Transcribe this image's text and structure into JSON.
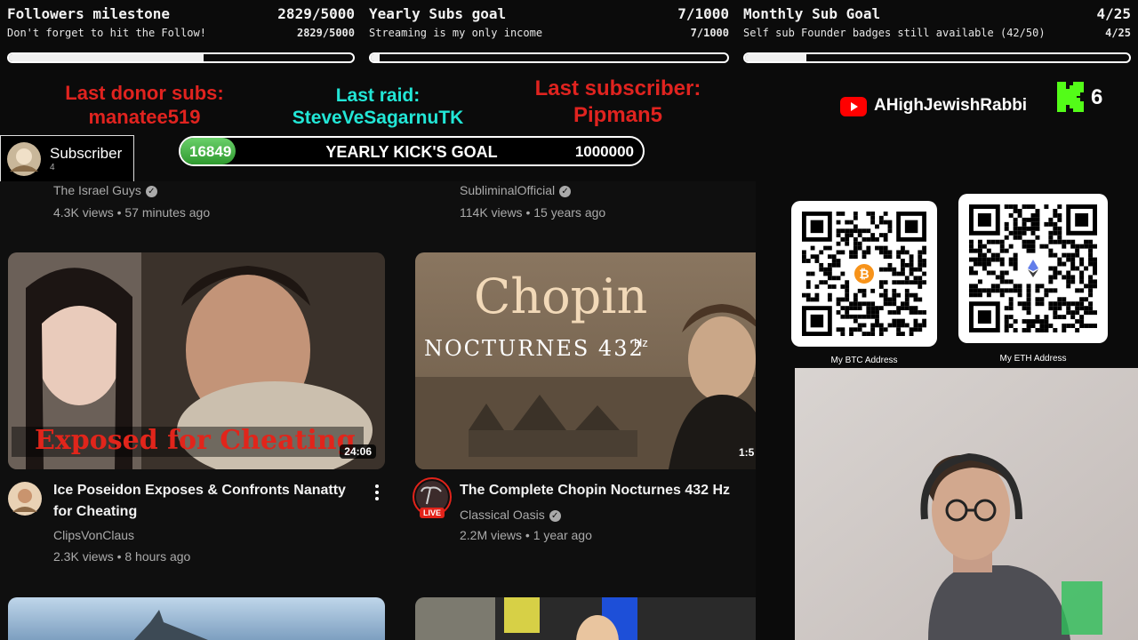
{
  "goals": [
    {
      "title": "Followers milestone",
      "value": "2829/5000",
      "subtitle": "Don't forget to hit the Follow!",
      "sub_value": "2829/5000",
      "progress": 0.566
    },
    {
      "title": "Yearly Subs goal",
      "value": "7/1000",
      "subtitle": "Streaming is my only income",
      "sub_value": "7/1000",
      "progress": 0.007
    },
    {
      "title": "Monthly Sub Goal",
      "value": "4/25",
      "subtitle": "Self sub Founder badges still available (42/50)",
      "sub_value": "4/25",
      "progress": 0.16
    }
  ],
  "alerts": {
    "donor_label": "Last donor subs:",
    "donor_name": "manatee519",
    "raid_label": "Last raid:",
    "raid_name": "SteveVeSagarnuTK",
    "sub_label": "Last subscriber:",
    "sub_name": "Pipman5"
  },
  "kick_goal": {
    "current": "16849",
    "title": "YEARLY KICK'S GOAL",
    "max": "1000000",
    "progress": 0.016849
  },
  "subscriber_box": {
    "label": "Subscriber",
    "count": "4"
  },
  "youtube": {
    "channel": "AHighJewishRabbi"
  },
  "kick_badge": {
    "count": "6"
  },
  "feed": {
    "top_left": {
      "channel": "The Israel Guys",
      "meta": "4.3K views • 57 minutes ago"
    },
    "top_right": {
      "channel": "SubliminalOfficial",
      "meta": "114K views • 15 years ago"
    },
    "video1": {
      "title_line1": "Ice Poseidon Exposes & Confronts Nanatty",
      "title_line2": "for Cheating",
      "channel": "ClipsVonClaus",
      "meta": "2.3K views • 8 hours ago",
      "duration": "24:06",
      "thumb_text": "Exposed for Cheating"
    },
    "video2": {
      "title": "The Complete Chopin Nocturnes 432 Hz",
      "channel": "Classical Oasis",
      "meta": "2.2M views • 1 year ago",
      "live_badge": "LIVE",
      "duration": "1:5",
      "thumb_title": "Chopin",
      "thumb_sub": "NOCTURNES 432",
      "thumb_hz": "Hz"
    }
  },
  "crypto": {
    "btc_label": "My BTC Address",
    "eth_label": "My ETH Address"
  },
  "colors": {
    "alert_red": "#e0231f",
    "raid_cyan": "#22e6d6",
    "kick_green": "#53fc18",
    "youtube_red": "#ff0000"
  }
}
